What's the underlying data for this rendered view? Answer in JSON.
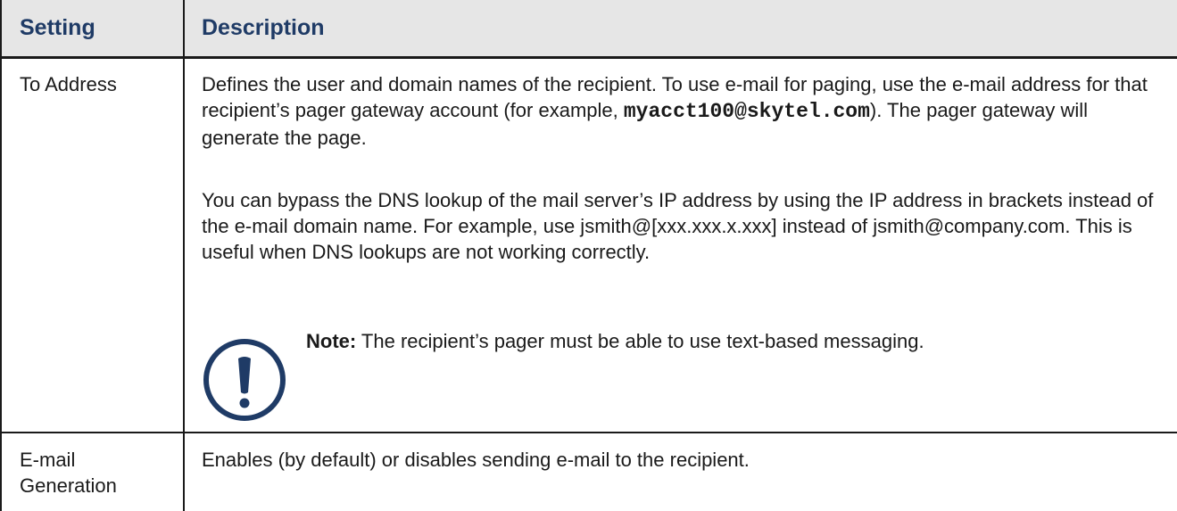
{
  "table": {
    "header": {
      "setting": "Setting",
      "description": "Description"
    },
    "rows": [
      {
        "setting": "To Address",
        "para1_before": "Defines the user and domain names of the recipient. To use e-mail for paging, use the e-mail address for that recipient’s pager gateway account (for example, ",
        "para1_code": "myacct100@skytel.com",
        "para1_after": "). The pager gateway will generate the page.",
        "para2": "You can bypass the DNS lookup of the mail server’s IP address by using the IP address in brackets instead of the e-mail domain name. For example, use jsmith@[xxx.xxx.x.xxx] instead of jsmith@company.com. This is useful when DNS lookups are not working correctly.",
        "note_label": "Note:",
        "note_text": " The recipient’s pager must be able to use text-based messaging.",
        "note_icon": "exclamation-circle-icon"
      },
      {
        "setting_line1": "E-mail",
        "setting_line2": "Generation",
        "description": "Enables (by default) or disables sending e-mail to the recipient."
      }
    ]
  },
  "colors": {
    "header_bg": "#e6e6e6",
    "header_text": "#1f3b66",
    "icon": "#1f3b66",
    "rule": "#1a1a1a"
  }
}
